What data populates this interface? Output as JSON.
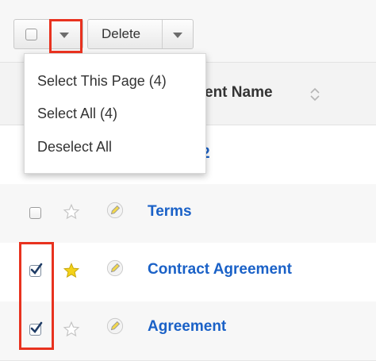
{
  "toolbar": {
    "delete_label": "Delete"
  },
  "menu": {
    "items": [
      {
        "label": "Select This Page (4)"
      },
      {
        "label": "Select All (4)"
      },
      {
        "label": "Deselect All"
      }
    ]
  },
  "table": {
    "column_header": "ent Name",
    "rows": [
      {
        "name": "2",
        "checked": false,
        "favorite": false
      },
      {
        "name": "Terms",
        "checked": false,
        "favorite": false
      },
      {
        "name": "Contract Agreement",
        "checked": true,
        "favorite": true
      },
      {
        "name": "Agreement",
        "checked": true,
        "favorite": false
      }
    ]
  },
  "colors": {
    "link": "#1a61c7",
    "highlight": "#e8321f",
    "star_gold": "#f4d21a"
  },
  "icons": [
    "caret-down-icon",
    "sort-icon",
    "star-icon",
    "pencil-icon",
    "checkmark-icon"
  ]
}
